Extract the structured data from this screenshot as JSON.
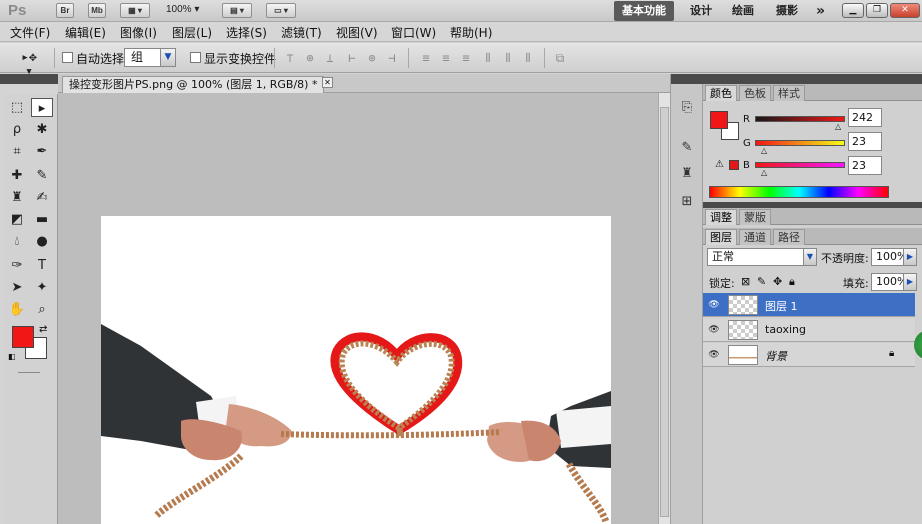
{
  "app": {
    "logo": "Ps",
    "bridge_btn": "Br",
    "minibridge_btn": "Mb",
    "zoom": "100%",
    "workspaces": [
      "基本功能",
      "设计",
      "绘画",
      "摄影"
    ],
    "more": "»"
  },
  "menu": [
    "文件(F)",
    "编辑(E)",
    "图像(I)",
    "图层(L)",
    "选择(S)",
    "滤镜(T)",
    "视图(V)",
    "窗口(W)",
    "帮助(H)"
  ],
  "options": {
    "auto_select_label": "自动选择:",
    "auto_select_value": "组",
    "show_transform_label": "显示变换控件"
  },
  "document": {
    "tab_title": "操控变形图片PS.png @ 100% (图层 1, RGB/8) *"
  },
  "color_panel": {
    "tabs": [
      "颜色",
      "色板",
      "样式"
    ],
    "r_label": "R",
    "r_value": "242",
    "g_label": "G",
    "g_value": "23",
    "b_label": "B",
    "b_value": "23",
    "foreground": "#f21717"
  },
  "adjust_panel": {
    "tabs": [
      "调整",
      "蒙版"
    ]
  },
  "layers_panel": {
    "tabs": [
      "图层",
      "通道",
      "路径"
    ],
    "blend_mode": "正常",
    "opacity_label": "不透明度:",
    "opacity_value": "100%",
    "lock_label": "锁定:",
    "fill_label": "填充:",
    "fill_value": "100%",
    "layers": [
      {
        "name": "图层 1",
        "selected": true
      },
      {
        "name": "taoxing",
        "selected": false
      },
      {
        "name": "背景",
        "selected": false
      }
    ]
  }
}
